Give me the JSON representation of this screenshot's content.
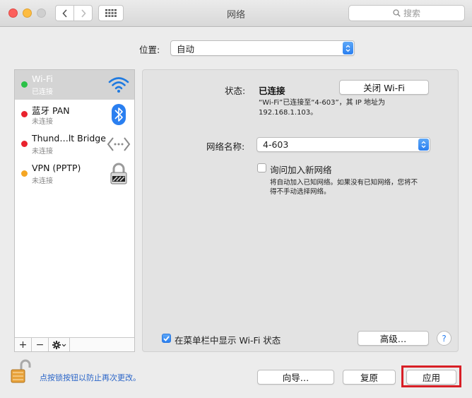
{
  "window": {
    "title": "网络",
    "search_placeholder": "搜索",
    "back_icon": "chevron-left-icon",
    "forward_icon": "chevron-right-icon",
    "grid_icon": "show-all-grid-icon"
  },
  "location": {
    "label": "位置:",
    "value": "自动"
  },
  "services": [
    {
      "name": "Wi-Fi",
      "status": "已连接",
      "status_color": "#2bc148",
      "icon": "wifi-icon",
      "selected": true
    },
    {
      "name": "蓝牙 PAN",
      "status": "未连接",
      "status_color": "#e9222e",
      "icon": "bluetooth-icon",
      "selected": false
    },
    {
      "name": "Thund…lt Bridge",
      "status": "未连接",
      "status_color": "#e9222e",
      "icon": "thunderbolt-bridge-icon",
      "selected": false
    },
    {
      "name": "VPN (PPTP)",
      "status": "未连接",
      "status_color": "#f5a623",
      "icon": "vpn-lock-icon",
      "selected": false
    }
  ],
  "sidebar_footer": {
    "add": "+",
    "remove": "−",
    "gear_icon": "gear-icon"
  },
  "detail": {
    "status_label": "状态:",
    "status_value": "已连接",
    "wifi_off_button": "关闭 Wi-Fi",
    "status_desc_line1": "“Wi-Fi”已连接至“4-603”，其 IP 地址为",
    "status_desc_line2": "192.168.1.103。",
    "network_name_label": "网络名称:",
    "network_name_value": "4-603",
    "ask_join_label": "询问加入新网络",
    "ask_join_checked": false,
    "ask_join_desc_line1": "将自动加入已知网络。如果没有已知网络，您将不",
    "ask_join_desc_line2": "得不手动选择网络。",
    "menubar_label": "在菜单栏中显示 Wi-Fi 状态",
    "menubar_checked": true,
    "advanced_button": "高级…",
    "help_button": "?"
  },
  "bottom": {
    "lock_text": "点按锁按钮以防止再次更改。",
    "assist_button": "向导…",
    "revert_button": "复原",
    "apply_button": "应用",
    "apply_highlight_color": "#d81f26"
  }
}
